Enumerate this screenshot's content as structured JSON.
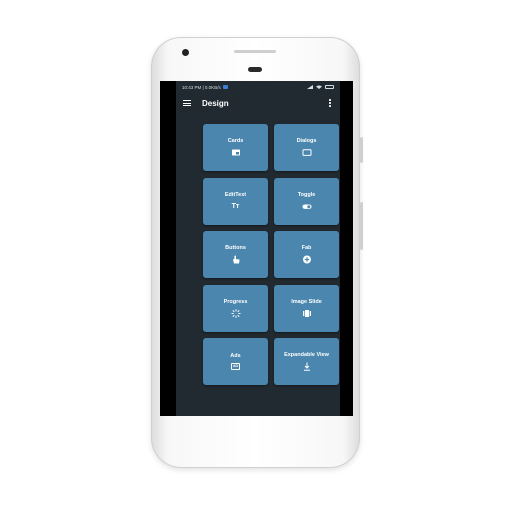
{
  "status_bar": {
    "time_speed": "10:43 PM | 0.0KB/s",
    "battery": ""
  },
  "toolbar": {
    "title": "Design"
  },
  "tiles": [
    {
      "label": "Cards",
      "icon": "cards-icon"
    },
    {
      "label": "Dialogs",
      "icon": "dialog-icon"
    },
    {
      "label": "EditText",
      "icon": "text-format-icon",
      "glyph": "Tт"
    },
    {
      "label": "Toggle",
      "icon": "toggle-icon"
    },
    {
      "label": "Buttons",
      "icon": "touch-icon"
    },
    {
      "label": "Fab",
      "icon": "add-circle-icon"
    },
    {
      "label": "Progress",
      "icon": "spinner-icon"
    },
    {
      "label": "Image Slide",
      "icon": "carousel-icon"
    },
    {
      "label": "Ads",
      "icon": "ad-icon",
      "glyph": "AD"
    },
    {
      "label": "Expandable View",
      "icon": "expand-down-icon"
    }
  ],
  "colors": {
    "app_background": "#222a31",
    "tile": "#4a86ad",
    "tile_text": "#ffffff"
  }
}
